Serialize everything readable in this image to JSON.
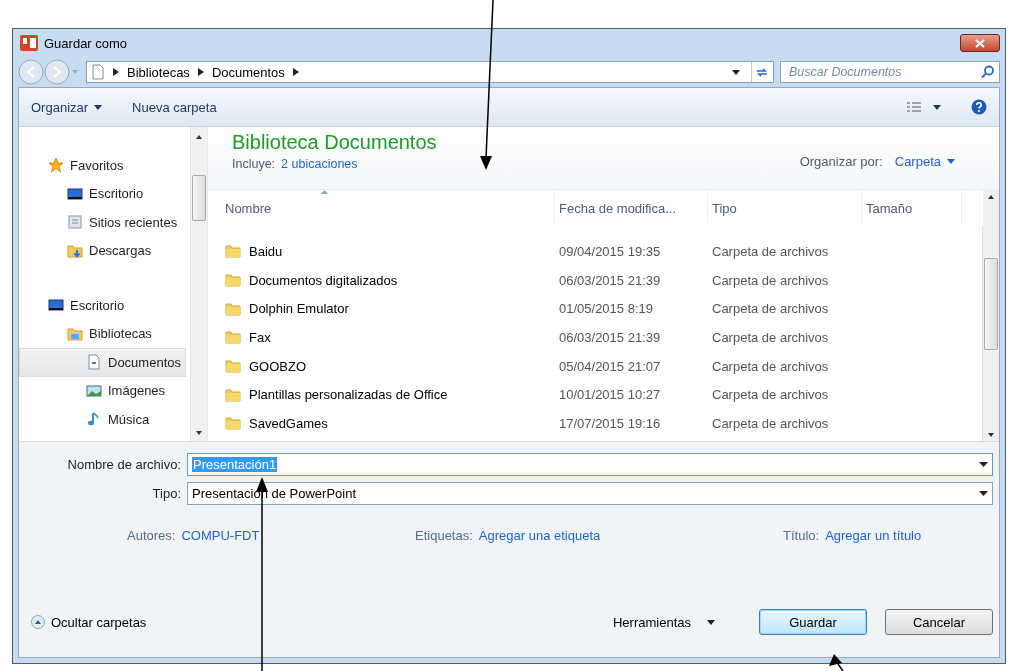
{
  "window": {
    "title": "Guardar como"
  },
  "address_bar": {
    "breadcrumb": [
      "Bibliotecas",
      "Documentos"
    ],
    "search": {
      "placeholder": "Buscar Documentos"
    }
  },
  "toolbar": {
    "organize": "Organizar",
    "new_folder": "Nueva carpeta"
  },
  "nav": [
    {
      "label": "Favoritos",
      "kind": "star",
      "selected": false,
      "children": [
        {
          "label": "Escritorio",
          "kind": "desktop",
          "selected": false
        },
        {
          "label": "Sitios recientes",
          "kind": "recent",
          "selected": false
        },
        {
          "label": "Descargas",
          "kind": "download",
          "selected": false
        }
      ]
    },
    {
      "label": "Escritorio",
      "kind": "desktop",
      "selected": false,
      "children": [
        {
          "label": "Bibliotecas",
          "kind": "library",
          "selected": false,
          "children": [
            {
              "label": "Documentos",
              "kind": "document",
              "selected": true
            },
            {
              "label": "Imágenes",
              "kind": "image",
              "selected": false
            },
            {
              "label": "Música",
              "kind": "music",
              "selected": false
            }
          ]
        }
      ]
    }
  ],
  "library": {
    "title": "Biblioteca Documentos",
    "includes_label": "Incluye:",
    "includes_link": "2 ubicaciones",
    "arrange_label": "Organizar por:",
    "arrange_value": "Carpeta"
  },
  "table": {
    "columns": [
      {
        "label": "Nombre",
        "sorted": true
      },
      {
        "label": "Fecha de modifica...",
        "sorted": false
      },
      {
        "label": "Tipo",
        "sorted": false
      },
      {
        "label": "Tamaño",
        "sorted": false
      }
    ],
    "rows": [
      {
        "name": "Baidu",
        "date": "09/04/2015 19:35",
        "type": "Carpeta de archivos"
      },
      {
        "name": "Documentos digitalizados",
        "date": "06/03/2015 21:39",
        "type": "Carpeta de archivos"
      },
      {
        "name": "Dolphin Emulator",
        "date": "01/05/2015 8:19",
        "type": "Carpeta de archivos"
      },
      {
        "name": "Fax",
        "date": "06/03/2015 21:39",
        "type": "Carpeta de archivos"
      },
      {
        "name": "GOOBZO",
        "date": "05/04/2015 21:07",
        "type": "Carpeta de archivos"
      },
      {
        "name": "Plantillas personalizadas de Office",
        "date": "10/01/2015 10:27",
        "type": "Carpeta de archivos"
      },
      {
        "name": "SavedGames",
        "date": "17/07/2015 19:16",
        "type": "Carpeta de archivos"
      }
    ]
  },
  "form": {
    "filename": {
      "label": "Nombre de archivo:",
      "value": "Presentación1"
    },
    "filetype": {
      "label": "Tipo:",
      "value": "Presentación de PowerPoint"
    },
    "metadata": [
      {
        "label": "Autores:",
        "value": "COMPU-FDT"
      },
      {
        "label": "Etiquetas:",
        "value": "Agregar una etiqueta"
      },
      {
        "label": "Título:",
        "value": "Agregar un título"
      }
    ]
  },
  "footer": {
    "hide_folders": "Ocultar carpetas",
    "tools": "Herramientas",
    "buttons": [
      {
        "label": "Guardar",
        "default": true
      },
      {
        "label": "Cancelar",
        "default": false
      }
    ]
  }
}
